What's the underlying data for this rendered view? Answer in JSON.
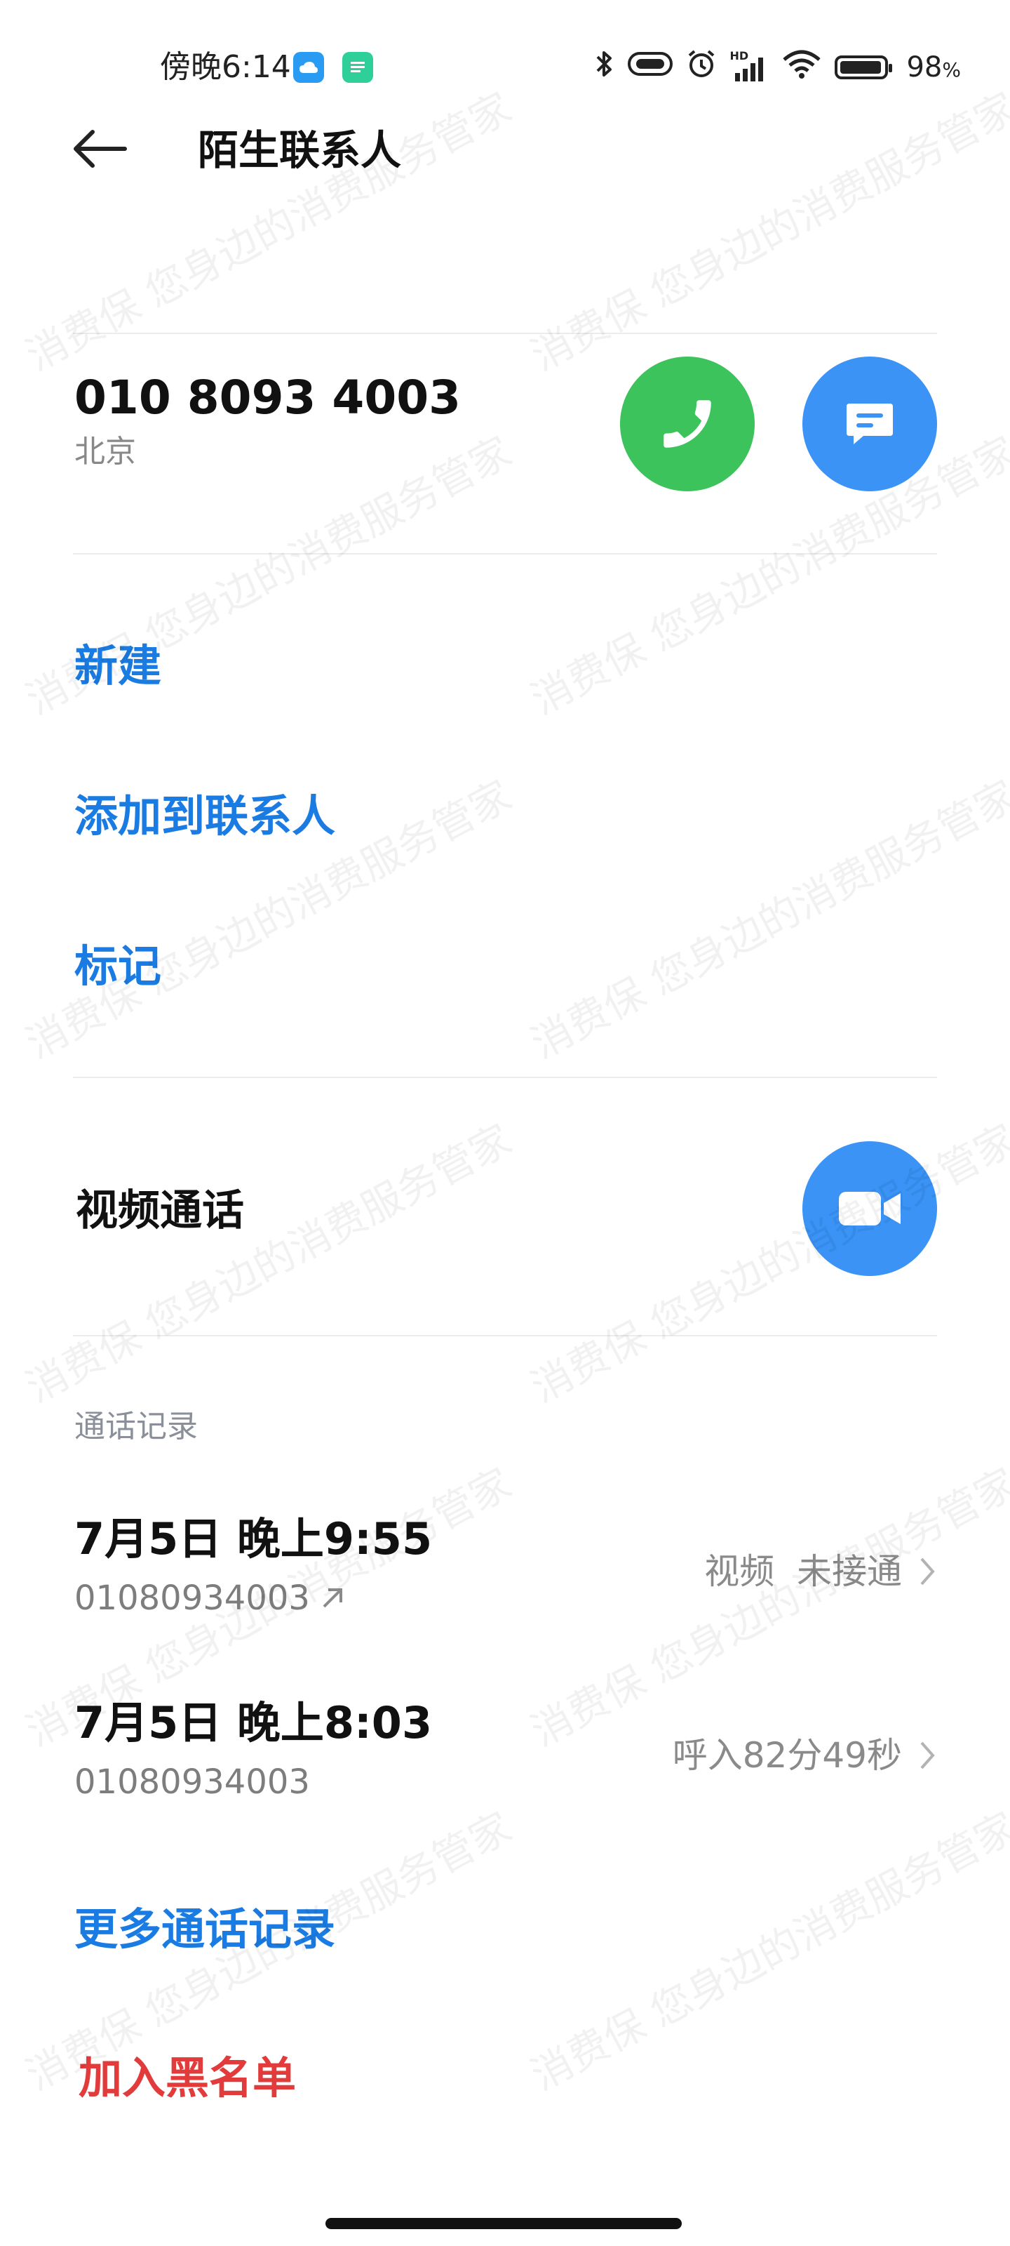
{
  "status_bar": {
    "time": "傍晚6:14",
    "battery": "98",
    "battery_unit": "%",
    "signal_label": "HD"
  },
  "header": {
    "title": "陌生联系人"
  },
  "contact": {
    "number": "010 8093 4003",
    "location": "北京"
  },
  "actions": {
    "new": "新建",
    "add_to_contacts": "添加到联系人",
    "mark": "标记"
  },
  "video_call": {
    "label": "视频通话"
  },
  "call_log": {
    "section_title": "通话记录",
    "records": [
      {
        "time": "7月5日 晚上9:55",
        "number": "01080934003",
        "status": "视频  未接通"
      },
      {
        "time": "7月5日 晚上8:03",
        "number": "01080934003",
        "status": "呼入82分49秒"
      }
    ],
    "more": "更多通话记录"
  },
  "blacklist": {
    "label": "加入黑名单"
  },
  "watermark": {
    "text": "消费保 您身边的消费服务管家"
  },
  "colors": {
    "call_green": "#3cc35b",
    "action_blue": "#3a93f5",
    "link_blue": "#1a7ce3",
    "danger_red": "#e23b3b"
  }
}
